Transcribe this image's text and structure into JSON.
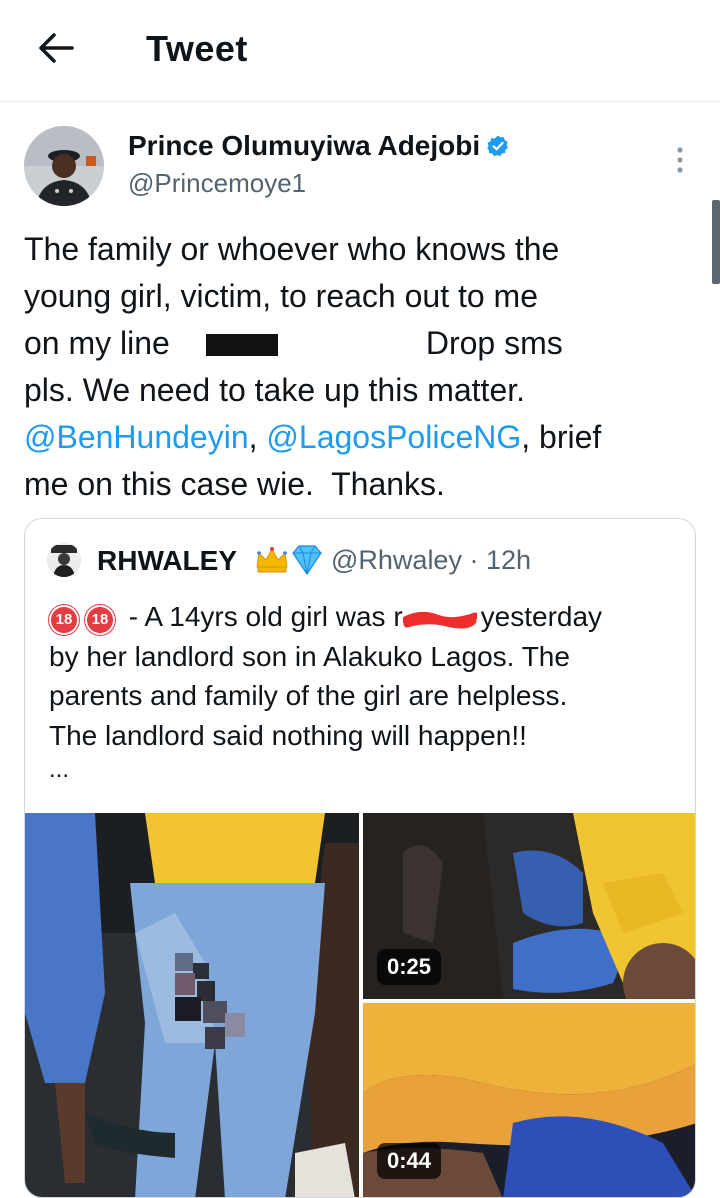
{
  "header": {
    "title": "Tweet"
  },
  "author": {
    "name": "Prince Olumuyiwa Adejobi",
    "handle": "@Princemoye1"
  },
  "tweet": {
    "line1": "The family or whoever who knows the",
    "line2": "young girl, victim, to reach out to me",
    "line3a": "on my line",
    "line3b": "Drop sms",
    "line4": "pls. We need to take up this matter.",
    "mention1": "@BenHundeyin",
    "sep": ", ",
    "mention2": "@LagosPoliceNG",
    "line5end": ", brief",
    "line6": "me on this case wie.  Thanks."
  },
  "quote": {
    "name": "RHWALEY",
    "handle_time": "@Rhwaley · 12h",
    "badge": "18",
    "line1a": " - A 14yrs old girl was r",
    "line1b": "yesterday",
    "line2": "by her landlord son in Alakuko Lagos. The",
    "line3": "parents and family of the girl are helpless.",
    "line4": "The landlord said nothing will happen!!",
    "ellipsis": "...",
    "video1_duration": "0:25",
    "video2_duration": "0:44"
  },
  "icons": [
    "back-arrow-icon",
    "verified-badge-icon",
    "more-vertical-icon",
    "crown-icon",
    "diamond-icon"
  ],
  "colors": {
    "link": "#1d9bf0",
    "secondary": "#536471",
    "verified": "#1d9bf0"
  }
}
